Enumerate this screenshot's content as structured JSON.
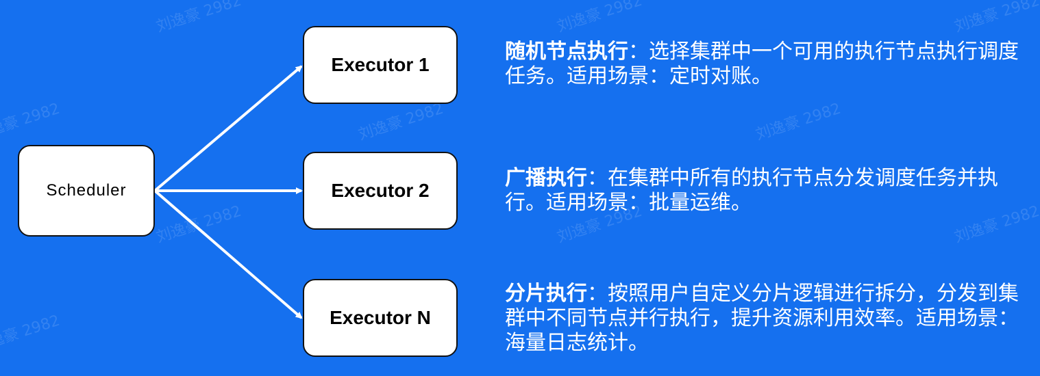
{
  "watermark": "刘逸豪 2982",
  "scheduler": {
    "label": "Scheduler"
  },
  "executors": [
    {
      "label": "Executor 1"
    },
    {
      "label": "Executor 2"
    },
    {
      "label": "Executor N"
    }
  ],
  "descriptions": [
    {
      "title": "随机节点执行",
      "sep": "：",
      "text": "选择集群中一个可用的执行节点执行调度任务。适用场景：定时对账。"
    },
    {
      "title": "广播执行",
      "sep": "：",
      "text": "在集群中所有的执行节点分发调度任务并执行。适用场景：批量运维。"
    },
    {
      "title": "分片执行",
      "sep": "：",
      "text": "按照用户自定义分片逻辑进行拆分，分发到集群中不同节点并行执行，提升资源利用效率。适用场景：海量日志统计。"
    }
  ],
  "colors": {
    "background": "#1570ef",
    "arrow": "#ffffff",
    "box": "#ffffff"
  }
}
